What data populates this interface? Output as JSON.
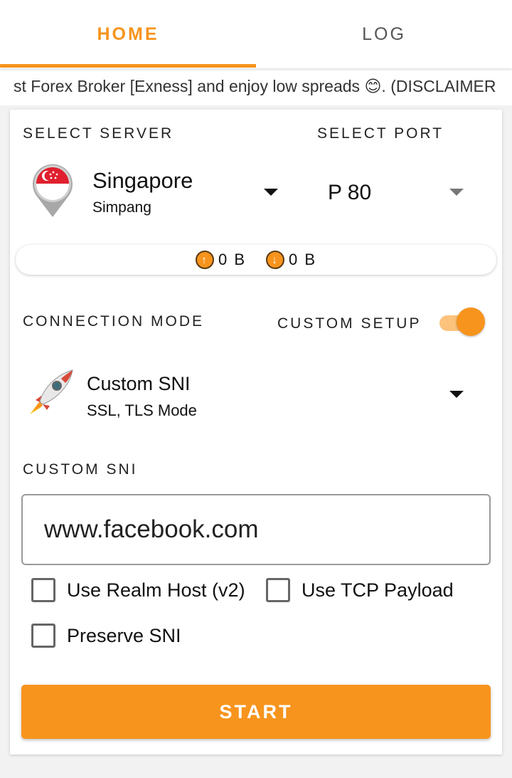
{
  "tabs": [
    {
      "label": "HOME",
      "active": true
    },
    {
      "label": "LOG",
      "active": false
    }
  ],
  "marquee": {
    "text": "st Forex Broker [Exness] and enjoy low spreads 😊. (DISCLAIMER"
  },
  "server": {
    "section_label": "SELECT SERVER",
    "name": "Singapore",
    "subtitle": "Simpang",
    "flag_icon": "singapore-flag-pin-icon"
  },
  "port": {
    "section_label": "SELECT PORT",
    "value": "P 80"
  },
  "traffic": {
    "upload": "0 B",
    "download": "0 B"
  },
  "connection": {
    "section_label": "CONNECTION MODE",
    "custom_setup_label": "CUSTOM SETUP",
    "custom_setup_on": true,
    "mode_name": "Custom SNI",
    "mode_sub": "SSL, TLS Mode",
    "mode_icon": "rocket-icon"
  },
  "sni": {
    "section_label": "CUSTOM SNI",
    "value": "www.facebook.com"
  },
  "options": {
    "realm_host": {
      "label": "Use Realm Host (v2)",
      "checked": false
    },
    "tcp_payload": {
      "label": "Use TCP Payload",
      "checked": false
    },
    "preserve_sni": {
      "label": "Preserve SNI",
      "checked": false
    }
  },
  "start_button": {
    "label": "START"
  },
  "colors": {
    "accent": "#f7941d",
    "accent_light": "#fcc37c",
    "flag_red": "#e0202e"
  }
}
